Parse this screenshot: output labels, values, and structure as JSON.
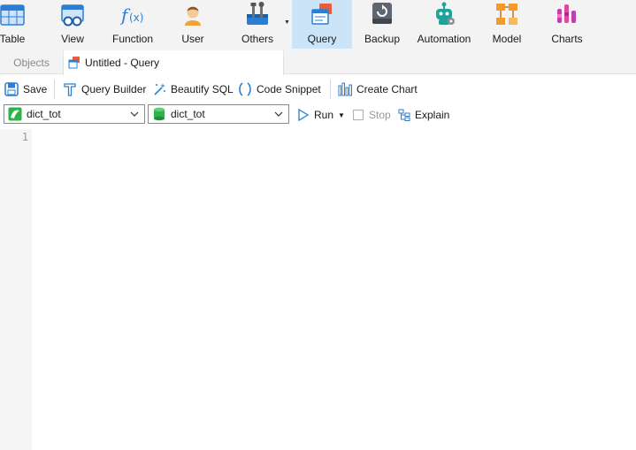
{
  "ribbon": {
    "items": [
      {
        "label": "Table",
        "icon": "table-icon"
      },
      {
        "label": "View",
        "icon": "view-icon"
      },
      {
        "label": "Function",
        "icon": "function-icon"
      },
      {
        "label": "User",
        "icon": "user-icon"
      },
      {
        "label": "Others",
        "icon": "others-icon"
      },
      {
        "label": "Query",
        "icon": "query-icon"
      },
      {
        "label": "Backup",
        "icon": "backup-icon"
      },
      {
        "label": "Automation",
        "icon": "automation-icon"
      },
      {
        "label": "Model",
        "icon": "model-icon"
      },
      {
        "label": "Charts",
        "icon": "charts-icon"
      }
    ],
    "active": "Query"
  },
  "tabs": {
    "objects_label": "Objects",
    "query_label": "Untitled - Query"
  },
  "toolbar": {
    "save_label": "Save",
    "query_builder_label": "Query Builder",
    "beautify_label": "Beautify SQL",
    "code_snippet_label": "Code Snippet",
    "create_chart_label": "Create Chart"
  },
  "runbar": {
    "connection_value": "dict_tot",
    "database_value": "dict_tot",
    "run_label": "Run",
    "stop_label": "Stop",
    "explain_label": "Explain"
  },
  "editor": {
    "line_numbers": [
      "1"
    ]
  },
  "colors": {
    "ribbon_bg": "#f3f3f3",
    "active_bg": "#cce4f7",
    "accent_blue": "#2a7fd4"
  }
}
